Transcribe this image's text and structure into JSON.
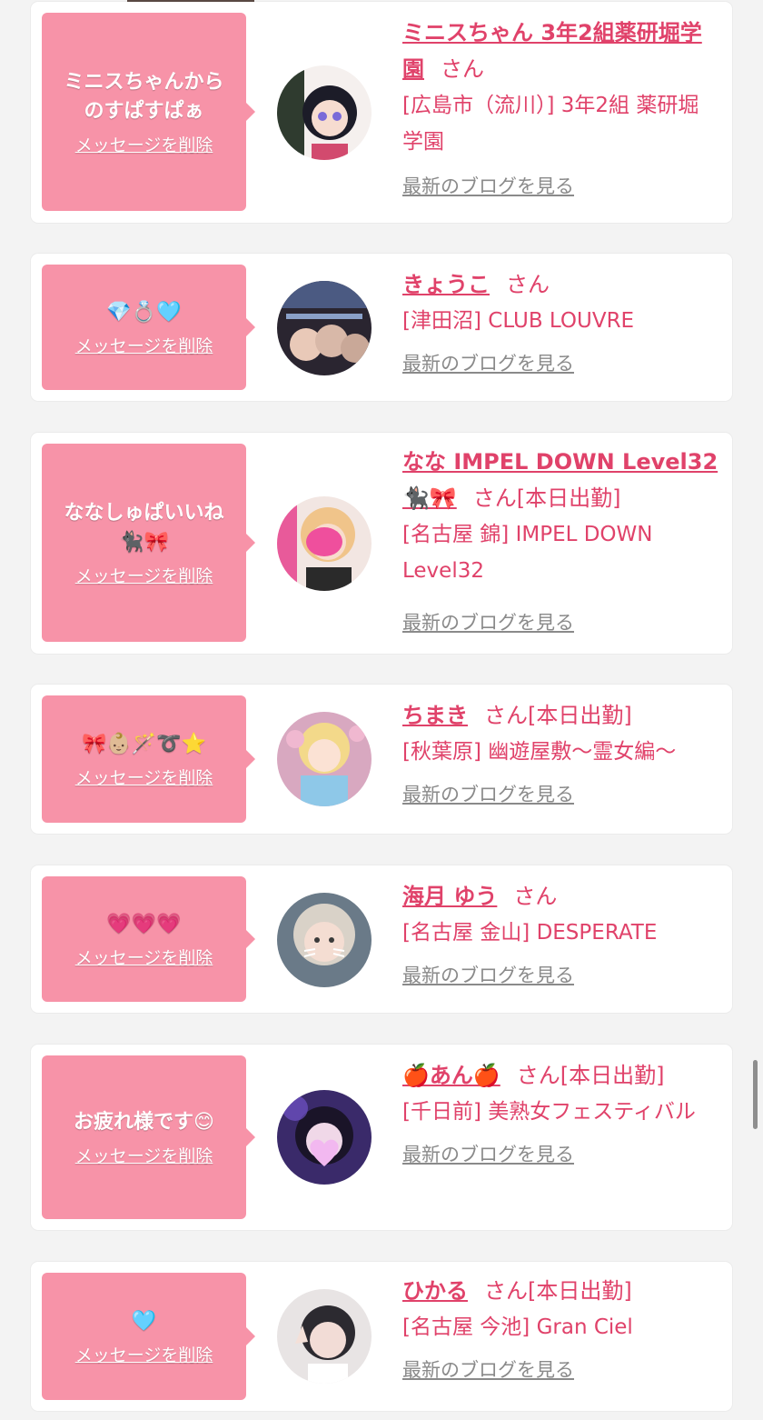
{
  "delete_label": "メッセージを削除",
  "blog_label": "最新のブログを見る",
  "san_label": "さん",
  "today_label": "[本日出勤]",
  "cards": [
    {
      "message": "ミニスちゃんから\nのすぱすぱぁ",
      "name": "ミニスちゃん 3年2組薬研堀学園",
      "shop": "[広島市（流川）] 3年2組 薬研堀学園",
      "today": false
    },
    {
      "message": "💎💍🩵",
      "name": "きょうこ",
      "shop": "[津田沼] CLUB LOUVRE",
      "today": false
    },
    {
      "message": "ななしゅぱいいね\n🐈‍⬛🎀",
      "name": "なな IMPEL DOWN Level32 🐈‍⬛🎀",
      "shop": "[名古屋 錦] IMPEL DOWN Level32",
      "today": true
    },
    {
      "message": "🎀👶🏼🪄➰⭐️",
      "name": "ちまき",
      "shop": "[秋葉原] 幽遊屋敷～霊女編～",
      "today": true
    },
    {
      "message": "💗💗💗",
      "name": "海月 ゆう",
      "shop": "[名古屋 金山] DESPERATE",
      "today": false
    },
    {
      "message": "お疲れ様です😊",
      "name": "🍎あん🍎",
      "shop": "[千日前] 美熟女フェスティバル",
      "today": true
    },
    {
      "message": "🩵",
      "name": "ひかる",
      "shop": "[名古屋 今池] Gran Ciel",
      "today": true
    }
  ]
}
